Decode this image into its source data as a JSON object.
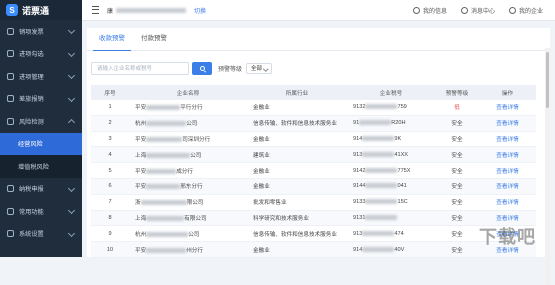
{
  "app": {
    "logo_text": "诺票通"
  },
  "sidebar": {
    "items": [
      {
        "label": "销项发票",
        "open": false
      },
      {
        "label": "进项勾选",
        "open": false
      },
      {
        "label": "进项管理",
        "open": false
      },
      {
        "label": "差旅报销",
        "open": false
      },
      {
        "label": "风险检测",
        "open": true
      },
      {
        "label": "经营风险",
        "sub": true,
        "active": true
      },
      {
        "label": "增值税风险",
        "sub": true,
        "active": false
      },
      {
        "label": "纳税申报",
        "open": false
      },
      {
        "label": "常用功能",
        "open": false
      },
      {
        "label": "系统设置",
        "open": false
      }
    ]
  },
  "topbar": {
    "company_prefix": "康",
    "switch_label": "切换",
    "my_messages": "我的信息",
    "messages": "消息中心",
    "my_company": "我的企业"
  },
  "tabs": [
    {
      "label": "收款预警",
      "active": true
    },
    {
      "label": "付款预警",
      "active": false
    }
  ],
  "filters": {
    "search_placeholder": "请输入企业名称或税号",
    "level_label": "预警等级",
    "level_value": "全部"
  },
  "table": {
    "headers": [
      "序号",
      "企业名称",
      "所属行业",
      "企业税号",
      "预警等级",
      "操作"
    ],
    "rows": [
      {
        "no": "1",
        "name_prefix": "平安",
        "name_suffix": "平行分行",
        "industry": "金融业",
        "tax_prefix": "9132",
        "tax_suffix": "759",
        "level": "低",
        "level_color": "#e24a4a",
        "action": "查看详情"
      },
      {
        "no": "2",
        "name_prefix": "杭州",
        "name_suffix": "公司",
        "industry": "信息传输、软件和信息技术服务业",
        "tax_prefix": "91",
        "tax_suffix": "R20H",
        "level": "安全",
        "action": "查看详情"
      },
      {
        "no": "3",
        "name_prefix": "平安",
        "name_suffix": "司深圳分行",
        "industry": "金融业",
        "tax_prefix": "914",
        "tax_suffix": "9K",
        "level": "安全",
        "action": "查看详情"
      },
      {
        "no": "4",
        "name_prefix": "上海",
        "name_suffix": "公司",
        "industry": "建筑业",
        "tax_prefix": "913",
        "tax_suffix": "41XX",
        "level": "安全",
        "action": "查看详情"
      },
      {
        "no": "5",
        "name_prefix": "平安",
        "name_suffix": "成分行",
        "industry": "金融业",
        "tax_prefix": "9142",
        "tax_suffix": "775X",
        "level": "安全",
        "action": "查看详情"
      },
      {
        "no": "6",
        "name_prefix": "平安",
        "name_suffix": "邢东分行",
        "industry": "金融业",
        "tax_prefix": "9144",
        "tax_suffix": "041",
        "level": "安全",
        "action": "查看详情"
      },
      {
        "no": "7",
        "name_prefix": "浙",
        "name_suffix": "限公司",
        "industry": "批发和零售业",
        "tax_prefix": "9133",
        "tax_suffix": "15C",
        "level": "安全",
        "action": "查看详情"
      },
      {
        "no": "8",
        "name_prefix": "上海",
        "name_suffix": "有限公司",
        "industry": "科学研究和技术服务业",
        "tax_prefix": "9131",
        "tax_suffix": "",
        "level": "安全",
        "action": "查看详情"
      },
      {
        "no": "9",
        "name_prefix": "杭州",
        "name_suffix": "公司",
        "industry": "信息传输、软件和信息技术服务业",
        "tax_prefix": "913",
        "tax_suffix": "474",
        "level": "安全",
        "action": "查看详情"
      },
      {
        "no": "10",
        "name_prefix": "平安",
        "name_suffix": "州分行",
        "industry": "金融业",
        "tax_prefix": "914",
        "tax_suffix": "40V",
        "level": "安全",
        "action": "查看详情"
      }
    ]
  },
  "watermark": "下载吧"
}
